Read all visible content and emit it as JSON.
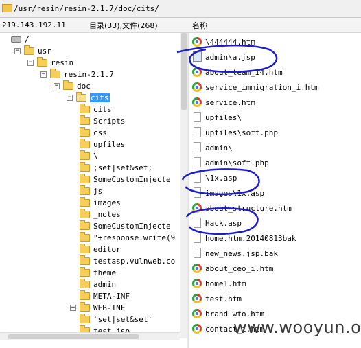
{
  "path_bar": {
    "path": "/usr/resin/resin-2.1.7/doc/cits/"
  },
  "status_bar": {
    "ip": "219.143.192.11",
    "counts": "目录(33),文件(268)",
    "name_header": "名称"
  },
  "tree": [
    {
      "label": "/",
      "icon": "drive-icon"
    },
    {
      "label": "usr",
      "icon": "folder-icon"
    },
    {
      "label": "resin",
      "icon": "folder-icon"
    },
    {
      "label": "resin-2.1.7",
      "icon": "folder-icon"
    },
    {
      "label": "doc",
      "icon": "folder-icon"
    },
    {
      "label": "cits",
      "icon": "folder-open-icon",
      "selected": true
    },
    {
      "label": "cits",
      "icon": "folder-icon"
    },
    {
      "label": "Scripts",
      "icon": "folder-icon"
    },
    {
      "label": "css",
      "icon": "folder-icon"
    },
    {
      "label": "upfiles",
      "icon": "folder-icon"
    },
    {
      "label": "\\",
      "icon": "folder-icon"
    },
    {
      "label": ";set|set&set;",
      "icon": "folder-icon"
    },
    {
      "label": "SomeCustomInjecte",
      "icon": "folder-icon"
    },
    {
      "label": "js",
      "icon": "folder-icon"
    },
    {
      "label": "images",
      "icon": "folder-icon"
    },
    {
      "label": "_notes",
      "icon": "folder-icon"
    },
    {
      "label": "SomeCustomInjecte",
      "icon": "folder-icon"
    },
    {
      "label": "\"+response.write(9",
      "icon": "folder-icon"
    },
    {
      "label": "editor",
      "icon": "folder-icon"
    },
    {
      "label": "testasp.vulnweb.co",
      "icon": "folder-icon"
    },
    {
      "label": "theme",
      "icon": "folder-icon"
    },
    {
      "label": "admin",
      "icon": "folder-icon"
    },
    {
      "label": "META-INF",
      "icon": "folder-icon"
    },
    {
      "label": "WEB-INF",
      "icon": "folder-icon",
      "expander": "+"
    },
    {
      "label": "`set|set&set`",
      "icon": "folder-icon"
    },
    {
      "label": "test.jsp",
      "icon": "folder-icon"
    }
  ],
  "files": [
    {
      "name": "\\444444.htm",
      "icon": "chrome-icon"
    },
    {
      "name": "admin\\a.jsp",
      "icon": "jsp-file-icon"
    },
    {
      "name": "about_team_i4.htm",
      "icon": "chrome-icon"
    },
    {
      "name": "service_immigration_i.htm",
      "icon": "chrome-icon"
    },
    {
      "name": "service.htm",
      "icon": "chrome-icon"
    },
    {
      "name": "upfiles\\",
      "icon": "blank-file-icon"
    },
    {
      "name": "upfiles\\soft.php",
      "icon": "blank-file-icon"
    },
    {
      "name": "admin\\",
      "icon": "blank-file-icon"
    },
    {
      "name": "admin\\soft.php",
      "icon": "blank-file-icon"
    },
    {
      "name": "\\1x.asp",
      "icon": "blank-file-icon"
    },
    {
      "name": "images\\1x.asp",
      "icon": "blank-file-icon"
    },
    {
      "name": "about_structure.htm",
      "icon": "chrome-icon"
    },
    {
      "name": "Hack.asp",
      "icon": "blank-file-icon"
    },
    {
      "name": "home.htm.20140813bak",
      "icon": "blank-file-icon"
    },
    {
      "name": "new_news.jsp.bak",
      "icon": "blank-file-icon"
    },
    {
      "name": "about_ceo_i.htm",
      "icon": "chrome-icon"
    },
    {
      "name": "home1.htm",
      "icon": "chrome-icon"
    },
    {
      "name": "test.htm",
      "icon": "chrome-icon"
    },
    {
      "name": "brand_wto.htm",
      "icon": "chrome-icon"
    },
    {
      "name": "contact_i.htm",
      "icon": "chrome-icon"
    }
  ],
  "watermark": "www.wooyun.org",
  "colors": {
    "selection": "#3399ff",
    "annotation": "#1c1cc8",
    "folder": "#f6cf5b"
  }
}
